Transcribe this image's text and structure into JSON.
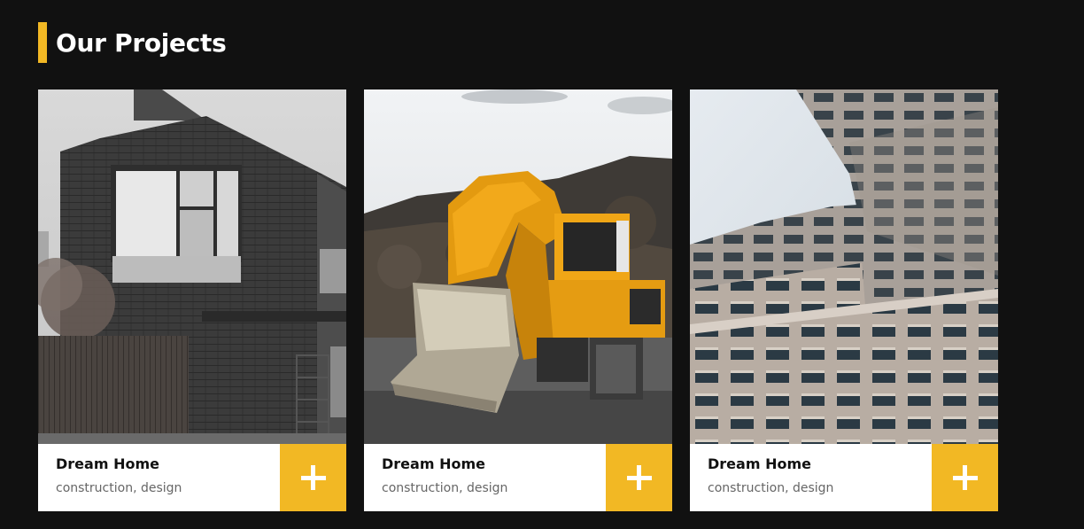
{
  "section": {
    "title": "Our Projects",
    "accent_color": "#f2b824"
  },
  "projects": [
    {
      "name": "Dream Home",
      "tags": "construction, design",
      "image": "dark-brick-house-photo",
      "action_icon": "plus-icon"
    },
    {
      "name": "Dream Home",
      "tags": "construction, design",
      "image": "yellow-excavator-photo",
      "action_icon": "plus-icon"
    },
    {
      "name": "Dream Home",
      "tags": "construction, design",
      "image": "modern-building-facade-photo",
      "action_icon": "plus-icon"
    }
  ]
}
